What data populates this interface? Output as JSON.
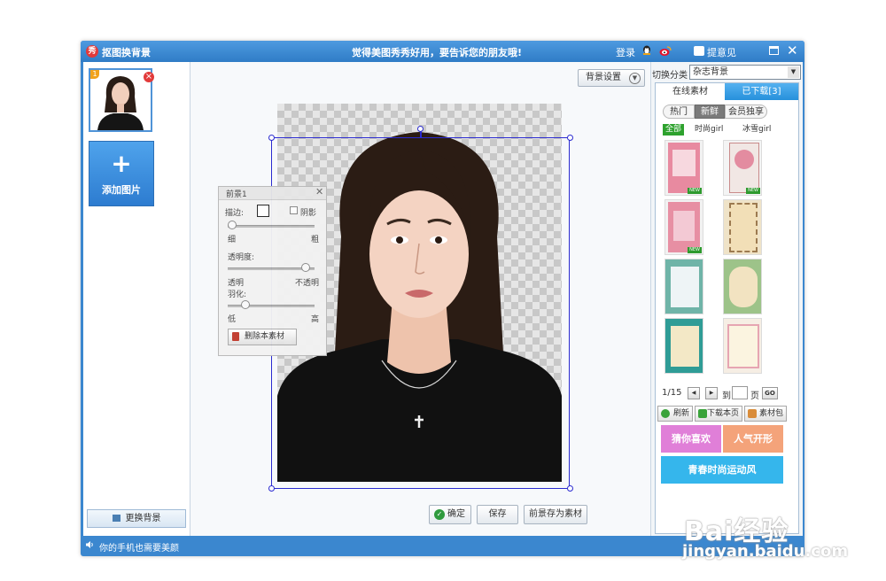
{
  "window": {
    "app_title": "抠图换背景",
    "slogan": "觉得美图秀秀好用，要告诉您的朋友哦!",
    "login": "登录",
    "feedback": "提意见"
  },
  "left": {
    "thumb_badge": "1",
    "add_image": "添加图片",
    "change_bg": "更换背景"
  },
  "toolbar": {
    "bg_settings": "背景设置"
  },
  "foreground_panel": {
    "title": "前景1",
    "stroke_label": "描边:",
    "shadow_label": "阴影",
    "thin": "细",
    "thick": "粗",
    "opacity_label": "透明度:",
    "transparent": "透明",
    "opaque": "不透明",
    "feather_label": "羽化:",
    "low": "低",
    "high": "高",
    "delete_button": "删除本素材",
    "stroke_value": 0.05,
    "opacity_value": 0.9,
    "feather_value": 0.2
  },
  "actions": {
    "confirm": "确定",
    "save": "保存",
    "save_as_material": "前景存为素材"
  },
  "right": {
    "switch_label": "切换分类",
    "category": "杂志背景",
    "tab_online": "在线素材",
    "tab_downloaded": "已下载[3]",
    "subtab_hot": "热门",
    "subtab_new": "新鲜",
    "subtab_vip": "会员独享",
    "cat_all": "全部",
    "cat_fashion": "时尚girl",
    "cat_ice": "冰雪girl",
    "new_badge": "NEW",
    "page_indicator": "1/15",
    "goto_label": "到",
    "page_unit": "页",
    "go": "GO",
    "refresh": "刷新",
    "download_page": "下载本页",
    "material_pack": "素材包",
    "promo_guess": "猜你喜欢",
    "promo_popular": "人气开形",
    "promo_youth": "青春时尚运动风"
  },
  "status": {
    "text": "你的手机也需要美颜"
  },
  "watermark": {
    "brand": "Bai经验",
    "url": "jingyan.baidu.com"
  },
  "colors": {
    "title_bar": "#3b87cf",
    "accent_blue": "#2f7cd0",
    "tab_active": "#2f96e0",
    "promo_pink": "#e07fd8",
    "promo_orange": "#f4a37a",
    "promo_cyan": "#35b6ec"
  }
}
